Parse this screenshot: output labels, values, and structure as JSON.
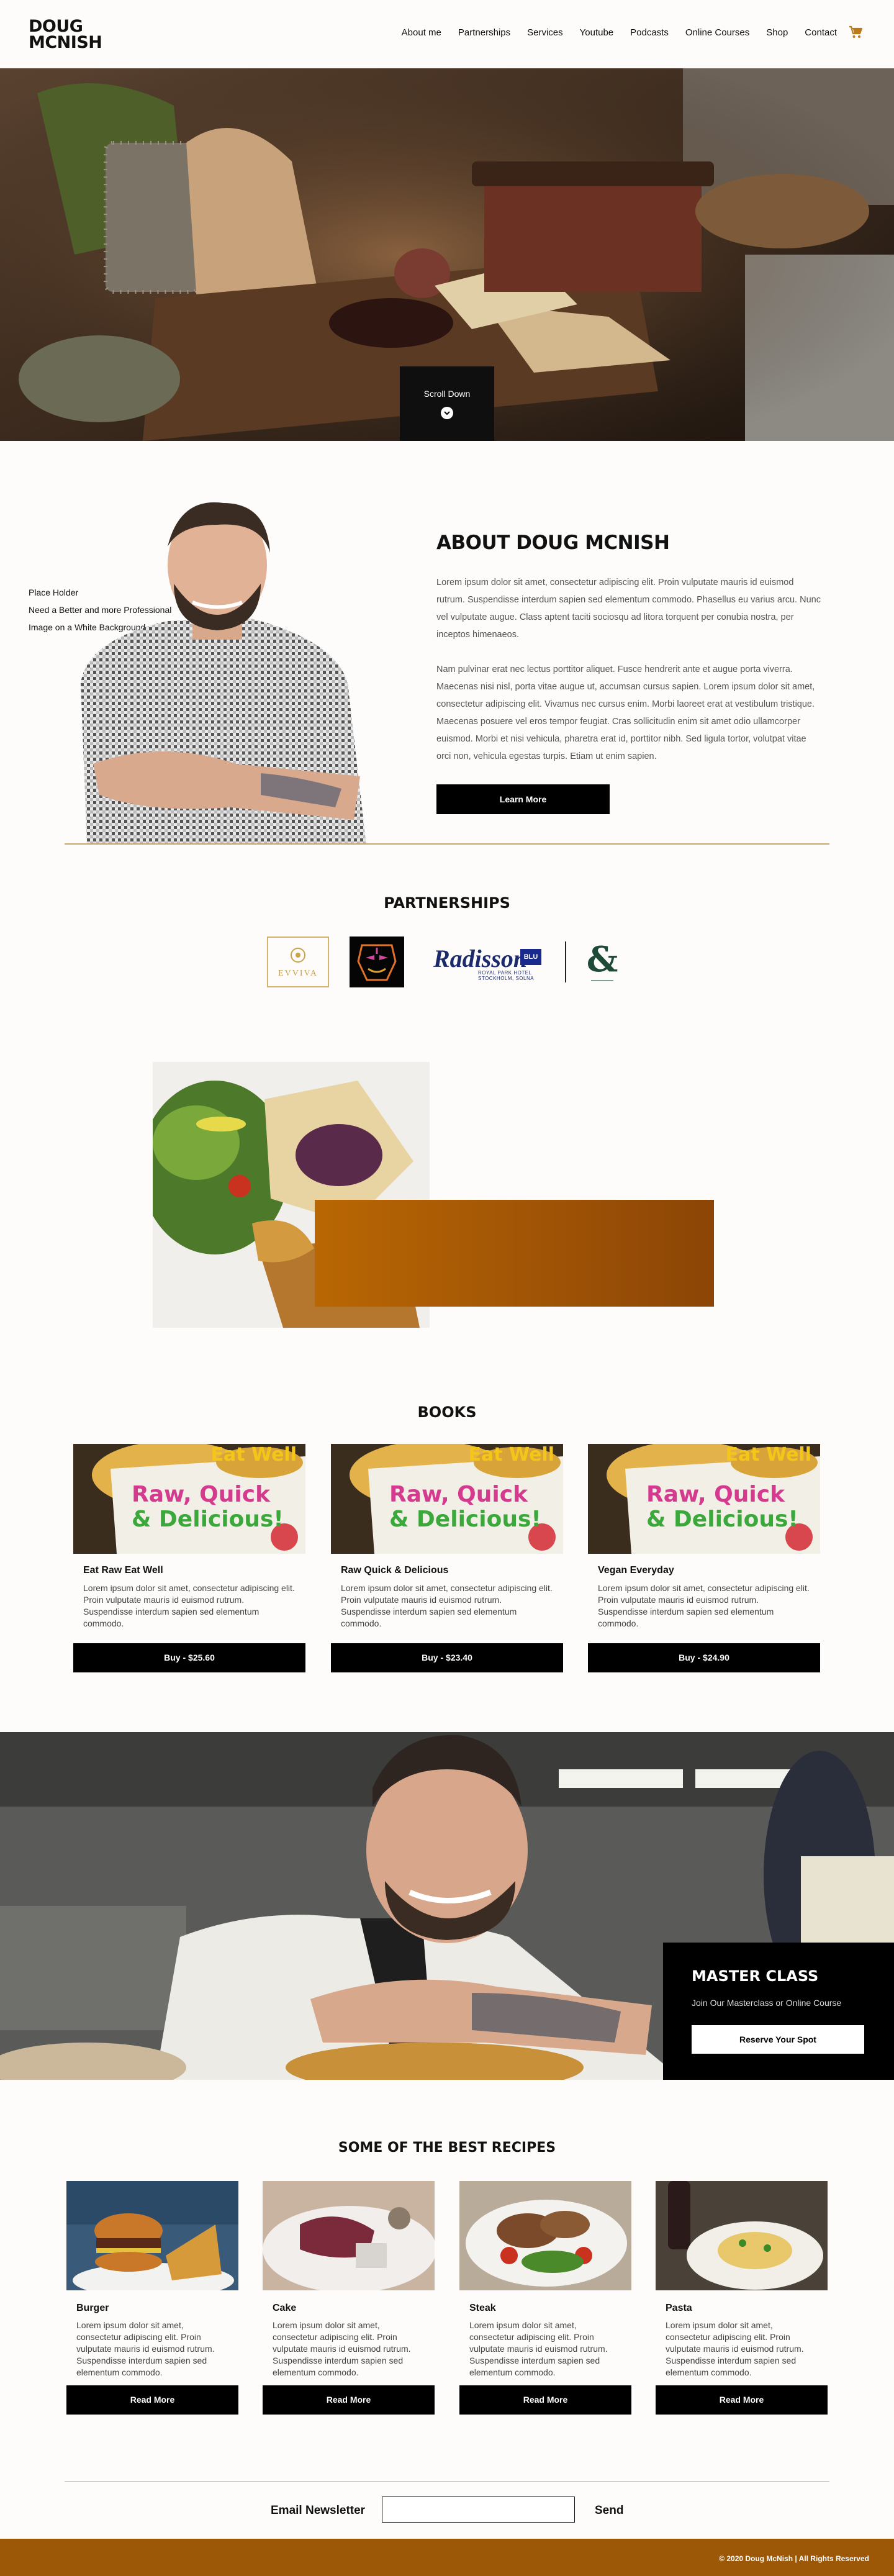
{
  "header": {
    "logo_line1": "DOUG",
    "logo_line2": "MCNISH",
    "nav": [
      "About me",
      "Partnerships",
      "Services",
      "Youtube",
      "Podcasts",
      "Online Courses",
      "Shop",
      "Contact"
    ],
    "cart_icon": "cart-icon"
  },
  "hero": {
    "scroll_label": "Scroll Down",
    "scroll_icon": "chevron-down-icon"
  },
  "about": {
    "placeholder_lines": [
      "Place Holder",
      "Need a Better and more Professional",
      "Image on a White Background"
    ],
    "title": "ABOUT DOUG MCNISH",
    "paragraph1": "Lorem ipsum dolor sit amet, consectetur adipiscing elit. Proin vulputate mauris id euismod rutrum. Suspendisse interdum sapien sed elementum commodo. Phasellus eu varius arcu. Nunc vel vulputate augue. Class aptent taciti sociosqu ad litora torquent per conubia nostra, per inceptos himenaeos.",
    "paragraph2": "Nam pulvinar erat nec lectus porttitor aliquet. Fusce hendrerit ante et augue porta viverra. Maecenas nisi nisl, porta vitae augue ut, accumsan cursus sapien. Lorem ipsum dolor sit amet, consectetur adipiscing elit. Vivamus nec cursus enim. Morbi laoreet erat at vestibulum tristique. Maecenas posuere vel eros tempor feugiat. Cras sollicitudin enim sit amet odio ullamcorper euismod. Morbi et nisi vehicula, pharetra erat id, porttitor nibh. Sed ligula tortor, volutpat vitae orci non, vehicula egestas turpis. Etiam ut enim sapien.",
    "button": "Learn More"
  },
  "partnerships": {
    "title": "PARTNERSHIPS",
    "evviva": "EVVIVA",
    "radisson": "Radisson",
    "radisson_badge": "BLU",
    "radisson_sub1": "ROYAL PARK HOTEL",
    "radisson_sub2": "STOCKHOLM, SOLNA"
  },
  "books": {
    "title": "BOOKS",
    "cover_top": "Eat Well",
    "cover_line1": "Raw, Quick",
    "cover_line2": "& Delicious!",
    "items": [
      {
        "name": "Eat Raw Eat Well",
        "desc": "Lorem ipsum dolor sit amet, consectetur adipiscing elit. Proin vulputate mauris id euismod rutrum. Suspendisse interdum sapien sed elementum commodo.",
        "button": "Buy - $25.60"
      },
      {
        "name": "Raw Quick & Delicious",
        "desc": "Lorem ipsum dolor sit amet, consectetur adipiscing elit. Proin vulputate mauris id euismod rutrum. Suspendisse interdum sapien sed elementum commodo.",
        "button": "Buy - $23.40"
      },
      {
        "name": "Vegan Everyday",
        "desc": "Lorem ipsum dolor sit amet, consectetur adipiscing elit. Proin vulputate mauris id euismod rutrum. Suspendisse interdum sapien sed elementum commodo.",
        "button": "Buy - $24.90"
      }
    ]
  },
  "master": {
    "title": "MASTER CLASS",
    "subtitle": "Join Our Masterclass or Online Course",
    "button": "Reserve Your Spot"
  },
  "recipes": {
    "title": "SOME OF THE BEST RECIPES",
    "items": [
      {
        "name": "Burger",
        "desc": "Lorem ipsum dolor sit amet, consectetur adipiscing elit. Proin vulputate mauris id euismod rutrum. Suspendisse interdum sapien sed elementum commodo.",
        "button": "Read More"
      },
      {
        "name": "Cake",
        "desc": "Lorem ipsum dolor sit amet, consectetur adipiscing elit. Proin vulputate mauris id euismod rutrum. Suspendisse interdum sapien sed elementum commodo.",
        "button": "Read More"
      },
      {
        "name": "Steak",
        "desc": "Lorem ipsum dolor sit amet, consectetur adipiscing elit. Proin vulputate mauris id euismod rutrum. Suspendisse interdum sapien sed elementum commodo.",
        "button": "Read More"
      },
      {
        "name": "Pasta",
        "desc": "Lorem ipsum dolor sit amet, consectetur adipiscing elit. Proin vulputate mauris id euismod rutrum. Suspendisse interdum sapien sed elementum commodo.",
        "button": "Read More"
      }
    ]
  },
  "newsletter": {
    "label": "Email Newsletter",
    "placeholder": "",
    "send": "Send"
  },
  "footer": {
    "text": "© 2020 Doug McNish | All Rights Reserved"
  },
  "colors": {
    "accent_gold": "#c8a56a",
    "accent_orange": "#b96704",
    "footer_brown": "#9c5806",
    "button_black": "#000000"
  }
}
